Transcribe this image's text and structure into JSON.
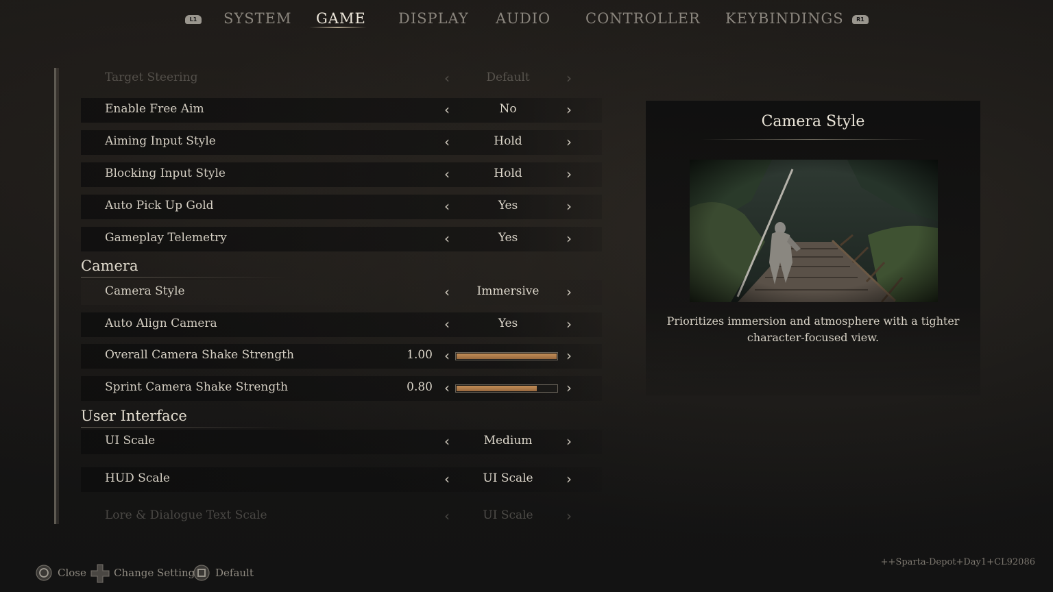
{
  "nav": {
    "left_bumper": "L1",
    "right_bumper": "R1",
    "tabs": [
      {
        "label": "SYSTEM"
      },
      {
        "label": "GAME"
      },
      {
        "label": "DISPLAY"
      },
      {
        "label": "AUDIO"
      },
      {
        "label": "CONTROLLER"
      },
      {
        "label": "KEYBINDINGS"
      }
    ],
    "active_tab": "GAME"
  },
  "settings": {
    "top_faded": {
      "label": "Target Steering",
      "value": "Default"
    },
    "rows": [
      {
        "label": "Enable Free Aim",
        "value": "No"
      },
      {
        "label": "Aiming Input Style",
        "value": "Hold"
      },
      {
        "label": "Blocking Input Style",
        "value": "Hold"
      },
      {
        "label": "Auto Pick Up Gold",
        "value": "Yes"
      },
      {
        "label": "Gameplay Telemetry",
        "value": "Yes"
      }
    ],
    "camera_section": "Camera",
    "camera_rows": [
      {
        "label": "Camera Style",
        "value": "Immersive"
      },
      {
        "label": "Auto Align Camera",
        "value": "Yes"
      }
    ],
    "sliders": [
      {
        "label": "Overall Camera Shake Strength",
        "value": "1.00",
        "fraction": 1.0
      },
      {
        "label": "Sprint Camera Shake Strength",
        "value": "0.80",
        "fraction": 0.8
      }
    ],
    "ui_section": "User Interface",
    "ui_rows": [
      {
        "label": "UI Scale",
        "value": "Medium"
      },
      {
        "label": "HUD Scale",
        "value": "UI Scale"
      }
    ],
    "bottom_faded": {
      "label": "Lore & Dialogue Text Scale",
      "value": "UI Scale"
    }
  },
  "info": {
    "title": "Camera Style",
    "description": "Prioritizes immersion and atmosphere with a tighter character-focused view."
  },
  "footer": {
    "close": "Close",
    "change": "Change Setting",
    "default": "Default",
    "build": "++Sparta-Depot+Day1+CL92086"
  },
  "colors": {
    "slider_fill": "#b07d4a",
    "text": "#d7d2c8",
    "background": "#141414"
  }
}
